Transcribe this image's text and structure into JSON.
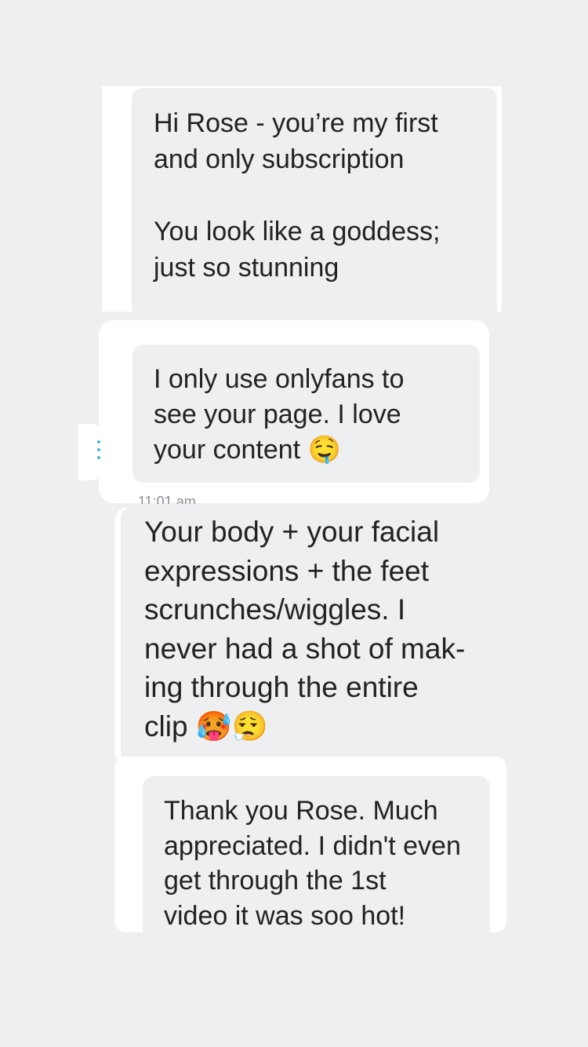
{
  "messages": [
    {
      "text": "Hi Rose - you’re my first\nand only subscription\n\nYou look like a goddess;\njust so stunning"
    },
    {
      "text": "I only use onlyfans to\nsee your page. I love\nyour content ",
      "emojis": [
        "🤤"
      ]
    },
    {
      "text": "Your body + your facial\nexpressions + the feet\nscrunches/wiggles. I\nnever had a shot of mak-\ning through the entire\nclip ",
      "emojis": [
        "🥵",
        "😮‍💨"
      ]
    },
    {
      "text": "Thank you Rose. Much\nappreciated. I didn't even\nget through the 1st\nvideo it was soo hot!"
    }
  ],
  "timestamp": "11:01 am",
  "icons": {
    "options": "more-vertical-icon",
    "accent_color": "#1aa3d6"
  }
}
